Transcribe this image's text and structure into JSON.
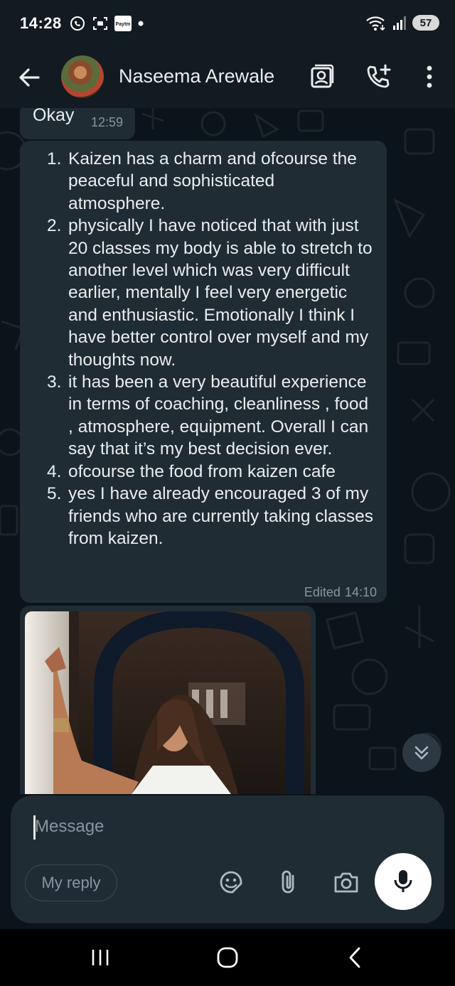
{
  "status_bar": {
    "time": "14:28",
    "icons_left": [
      "whatsapp-icon",
      "screenshot-icon",
      "paytm-icon",
      "dot-icon"
    ],
    "paytm_label": "Paytm",
    "icons_right": [
      "wifi-icon",
      "signal-icon"
    ],
    "battery": "57"
  },
  "header": {
    "contact_name": "Naseema Arewale",
    "icons": [
      "back-arrow-icon",
      "contact-card-icon",
      "add-call-icon",
      "more-vert-icon"
    ]
  },
  "messages": {
    "okay": {
      "text": "Okay",
      "time": "12:59"
    },
    "main": {
      "items": [
        {
          "num": "1.",
          "text": "Kaizen has a charm and ofcourse the peaceful and sophisticated atmosphere."
        },
        {
          "num": "2.",
          "text": "physically I have noticed that with just 20 classes my body is able to stretch to another level which was very difficult earlier, mentally I feel very energetic and enthusiastic. Emotionally I think I have better control over myself and my thoughts now."
        },
        {
          "num": "3.",
          "text": "it has been a very beautiful experience in terms of coaching, cleanliness , food , atmosphere, equipment. Overall I can say that it’s my best decision ever."
        },
        {
          "num": "4.",
          "text": "ofcourse the food from kaizen cafe"
        },
        {
          "num": "5.",
          "text": "yes I have already encouraged 3 of my friends who are currently taking classes from kaizen."
        }
      ],
      "edited_label": "Edited",
      "time": "14:10"
    },
    "image_message": {
      "icon": "photo-icon"
    }
  },
  "scroll_button": {
    "icon": "double-chevron-down-icon"
  },
  "composer": {
    "placeholder": "Message",
    "my_reply_label": "My reply",
    "icons": [
      "sticker-icon",
      "attach-icon",
      "camera-icon",
      "mic-icon"
    ]
  },
  "nav_bar": {
    "icons": [
      "recents-icon",
      "home-icon",
      "back-icon"
    ]
  },
  "colors": {
    "background": "#0b141a",
    "bubble": "#202c33",
    "header": "#111b21",
    "muted_text": "#8696a0"
  }
}
